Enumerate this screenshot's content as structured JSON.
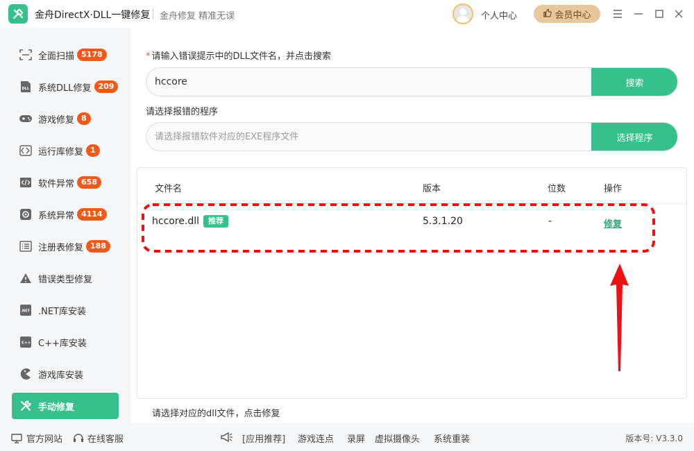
{
  "titlebar": {
    "app_title": "金舟DirectX·DLL一键修复",
    "subtitle": "金舟修复 精准无误",
    "personal_center": "个人中心",
    "vip_center": "会员中心",
    "icons": [
      "logo-wrench-icon",
      "avatar",
      "thumb-up-icon",
      "menu-icon",
      "minimize-icon",
      "maximize-icon",
      "close-icon"
    ]
  },
  "sidebar": {
    "items": [
      {
        "label": "全面扫描",
        "badge": "5178",
        "icon": "scan-icon",
        "active": false
      },
      {
        "label": "系统DLL修复",
        "badge": "209",
        "icon": "dll-icon",
        "active": false
      },
      {
        "label": "游戏修复",
        "badge": "8",
        "icon": "gamepad-icon",
        "active": false
      },
      {
        "label": "运行库修复",
        "badge": "1",
        "icon": "runtime-icon",
        "active": false
      },
      {
        "label": "软件异常",
        "badge": "658",
        "icon": "code-icon",
        "active": false
      },
      {
        "label": "系统异常",
        "badge": "4114",
        "icon": "gear-icon",
        "active": false
      },
      {
        "label": "注册表修复",
        "badge": "188",
        "icon": "list-icon",
        "active": false
      },
      {
        "label": "错误类型修复",
        "badge": "",
        "icon": "warning-icon",
        "active": false
      },
      {
        "label": ".NET库安装",
        "badge": "",
        "icon": "dotnet-icon",
        "active": false
      },
      {
        "label": "C++库安装",
        "badge": "",
        "icon": "cpp-icon",
        "active": false
      },
      {
        "label": "游戏库安装",
        "badge": "",
        "icon": "pacman-icon",
        "active": false
      },
      {
        "label": "手动修复",
        "badge": "",
        "icon": "tools-icon",
        "active": true
      }
    ]
  },
  "main": {
    "dll_prompt_star": "*",
    "dll_prompt": "请输入错误提示中的DLL文件名，并点击搜索",
    "dll_input_value": "hccore",
    "search_button": "搜索",
    "exe_prompt": "请选择报错的程序",
    "exe_placeholder": "请选择报错软件对应的EXE程序文件",
    "select_button": "选择程序",
    "table": {
      "headers": {
        "filename": "文件名",
        "version": "版本",
        "bits": "位数",
        "action": "操作"
      },
      "rows": [
        {
          "filename": "hccore.dll",
          "tag": "推荐",
          "version": "5.3.1.20",
          "bits": "-",
          "action": "修复"
        }
      ]
    },
    "hint": "请选择对应的dll文件，点击修复"
  },
  "annotation": {
    "color": "#ee1111"
  },
  "footer": {
    "official_site": "官方网站",
    "online_service": "在线客服",
    "app_recommend": "[应用推荐]",
    "links": [
      "游戏连点",
      "录屏",
      "虚拟摄像头",
      "系统重装"
    ],
    "version": "版本号: V3.3.0"
  },
  "colors": {
    "accent": "#35c08c",
    "badge": "#ef5a1a",
    "vip": "#e9c79a"
  }
}
